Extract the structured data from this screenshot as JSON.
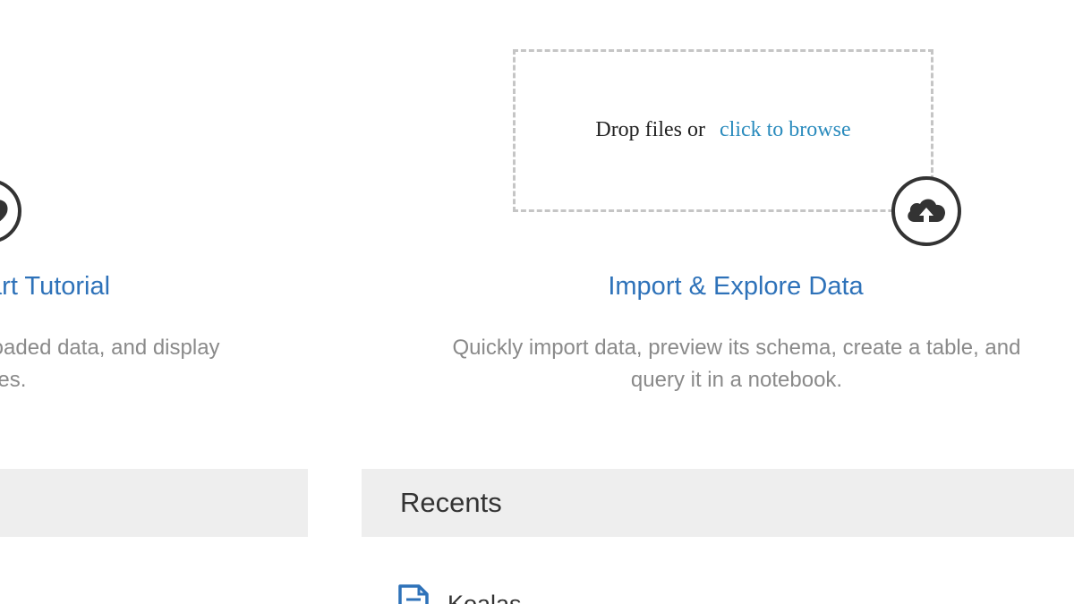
{
  "quickstart": {
    "title": "tart Tutorial",
    "description": "reloaded data, and display\nnutes."
  },
  "import": {
    "dropzone_text": "Drop files or",
    "browse_link": "click to browse",
    "title": "Import & Explore Data",
    "description": "Quickly import data, preview its schema, create a table, and\nquery it in a notebook."
  },
  "recents": {
    "title": "Recents",
    "items": [
      {
        "label": "Koalas",
        "icon": "notebook-icon"
      }
    ]
  },
  "colors": {
    "link": "#2e72b9",
    "browse_link": "#2a8bbd",
    "description": "#8a8a8a",
    "section_bg": "#eeeeee",
    "dashed_border": "#c5c5c5"
  }
}
